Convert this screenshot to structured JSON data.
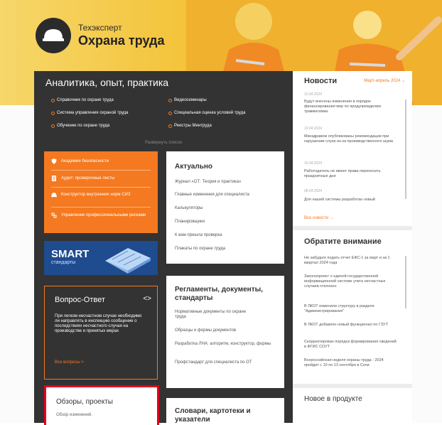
{
  "brand": {
    "subtitle": "Техэксперт",
    "title": "Охрана труда"
  },
  "analytics": {
    "title": "Аналитика, опыт, практика",
    "links_left": [
      "Справочник по охране труда",
      "Система управления охраной труда",
      "Обучение по охране труда"
    ],
    "links_right": [
      "Видеосеминары",
      "Специальная оценка условий труда",
      "Реестры Минтруда"
    ],
    "expand": "Развернуть список"
  },
  "orange_card": {
    "items": [
      "Академия безопасности",
      "Аудит: проверочные листы",
      "Конструктор внутренних норм СИЗ",
      "Управление профессиональными рисками"
    ],
    "icons": [
      "shield-icon",
      "checklist-icon",
      "helmet-icon",
      "risk-icon"
    ]
  },
  "smart": {
    "title": "SMART",
    "subtitle": "стандарты"
  },
  "qa": {
    "title": "Вопрос-Ответ",
    "nav": "<>",
    "body": "При легком несчастном случае необходимо ли направлять в инспекцию сообщение о последствиях несчастного случая на производстве и принятых мерах",
    "more": "Все вопросы >"
  },
  "reviews": {
    "title": "Обзоры, проекты",
    "body": "Обзор изменений."
  },
  "actual": {
    "title": "Актуально",
    "items": [
      "Журнал «ОТ: Теория и практика»",
      "Главные изменения для специалиста",
      "Калькуляторы",
      "Планировщики",
      "К вам пришла проверка",
      "Плакаты по охране труда"
    ]
  },
  "regulations": {
    "title": "Регламенты, документы, стандарты",
    "items": [
      "Нормативные документы по охране труда",
      "Образцы и формы документов",
      "Разработка ЛНА: алгоритм, конструктор, формы",
      "Профстандарт для специалиста по ОТ"
    ]
  },
  "dictionaries": {
    "title": "Словари, картотеки и указатели"
  },
  "news": {
    "title": "Новости",
    "period": "Март-апрель 2024",
    "items": [
      {
        "date": "10.04.2024",
        "text": "Будут внесены изменения в порядок финансирования мер по предупреждению травматизма"
      },
      {
        "date": "10.04.2024",
        "text": "Минздравом опубликованы рекомендации при нарушении слуха из-за производственного шума"
      },
      {
        "date": "10.04.2024",
        "text": "Работодатель не имеет права переносить праздничные дни"
      },
      {
        "date": "08.04.2024",
        "text": "Для нашей системы разработан новый"
      }
    ],
    "all": "Все новости →"
  },
  "attention": {
    "title": "Обратите внимание",
    "items": [
      "Не забудьте подать отчет ЕФС-1 за март и за 1 квартал 2024 года",
      "Законопроект о единой государственной информационной системе учета несчастных случаев отклонен",
      "В ЛКОТ изменили структуру в разделе \"Администрирование\"",
      "В ЛКОТ добавлен новый функционал по ГЗУТ",
      "Скорректирован порядок формирования сведений в ФГИС СОУТ",
      "Всероссийская неделя охраны труда - 2024 пройдет с 10 по 13 сентября в Сочи"
    ]
  },
  "product_news": {
    "title": "Новое в продукте"
  }
}
